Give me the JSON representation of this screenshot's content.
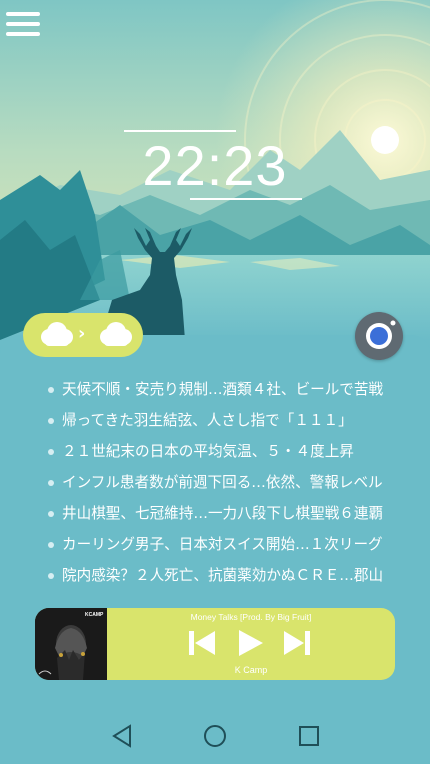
{
  "clock": {
    "time": "22:23"
  },
  "news": [
    "天候不順・安売り規制…酒類４社、ビールで苦戦",
    "帰ってきた羽生結弦、人さし指で「１１１」",
    "２１世紀末の日本の平均気温、５・４度上昇",
    "インフル患者数が前週下回る…依然、警報レベル",
    "井山棋聖、七冠維持…一力八段下し棋聖戦６連覇",
    "カーリング男子、日本対スイス開始…１次リーグ",
    "院内感染？２人死亡、抗菌薬効かぬＣＲＥ…郡山"
  ],
  "music": {
    "title": "Money Talks [Prod. By Big Fruit]",
    "artist": "K Camp",
    "album_label": "KCAMP"
  },
  "weather": {
    "from_icon": "cloud-icon",
    "to_icon": "cloud-icon"
  },
  "colors": {
    "accent": "#d9e46c",
    "panel": "#6bbcc8"
  }
}
